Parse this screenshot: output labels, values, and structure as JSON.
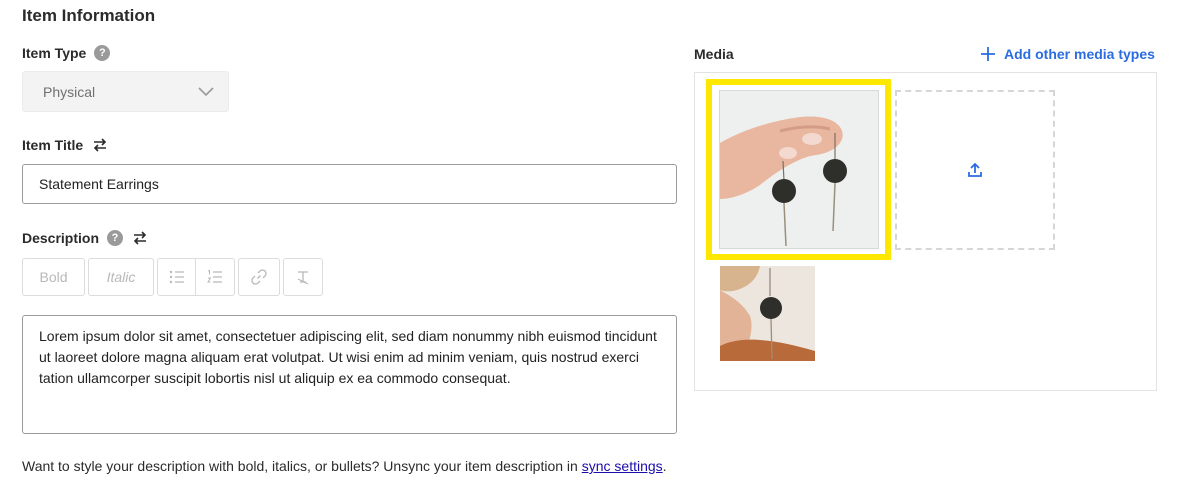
{
  "section": {
    "title": "Item Information"
  },
  "item_type": {
    "label": "Item Type",
    "help": "?",
    "selected": "Physical"
  },
  "item_title": {
    "label": "Item Title",
    "value": "Statement Earrings"
  },
  "description": {
    "label": "Description",
    "help": "?",
    "toolbar": {
      "bold": "Bold",
      "italic": "Italic"
    },
    "value": "Lorem ipsum dolor sit amet, consectetuer adipiscing elit, sed diam nonummy nibh euismod tincidunt ut laoreet dolore magna aliquam erat volutpat. Ut wisi enim ad minim veniam, quis nostrud exerci tation ullamcorper suscipit lobortis nisl ut aliquip ex ea commodo consequat."
  },
  "footnote": {
    "text": "Want to style your description with bold, italics, or bullets? Unsync your item description in ",
    "link": "sync settings",
    "end": "."
  },
  "media": {
    "label": "Media",
    "add_link": "Add other media types",
    "highlight_color": "#ffe800",
    "accent_color": "#2b6de0"
  }
}
